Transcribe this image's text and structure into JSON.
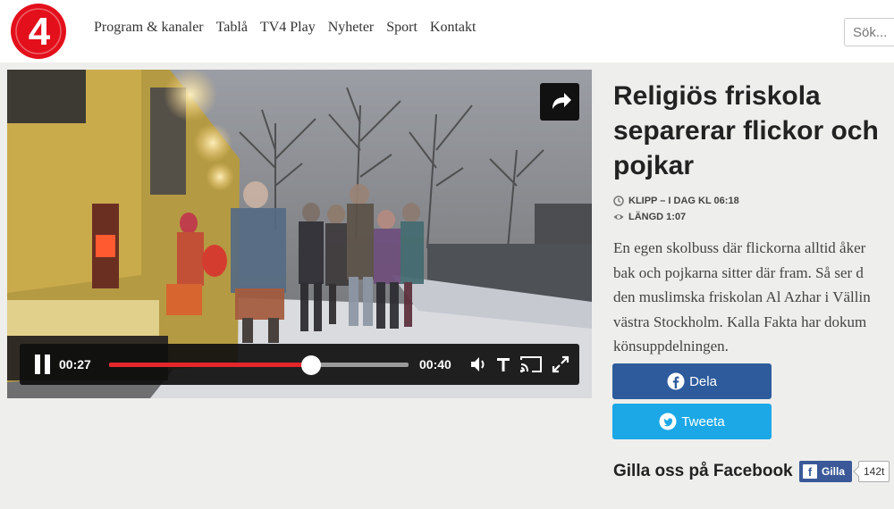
{
  "brand": {
    "logo_icon": "tv4-logo-icon",
    "logo_text": "4",
    "color": "#e3101b"
  },
  "nav": {
    "items": [
      {
        "label": "Program & kanaler"
      },
      {
        "label": "Tablå"
      },
      {
        "label": "TV4 Play"
      },
      {
        "label": "Nyheter"
      },
      {
        "label": "Sport"
      },
      {
        "label": "Kontakt"
      }
    ]
  },
  "search": {
    "placeholder": "Sök..."
  },
  "player": {
    "current_time": "00:27",
    "duration": "00:40",
    "progress_fraction": 0.675,
    "progress_color": "#e5262a",
    "icons": [
      "share-icon",
      "pause-icon",
      "volume-icon",
      "subtitles-icon",
      "cast-icon",
      "fullscreen-icon"
    ]
  },
  "article": {
    "title": "Religiös friskola separerar flickor och pojkar",
    "meta_clip": "KLIPP – I DAG KL 06:18",
    "meta_length": "LÄNGD 1:07",
    "lead_lines": [
      "En egen skolbuss där flickorna alltid åker",
      "bak och pojkarna sitter där fram. Så ser d",
      "den muslimska friskolan Al Azhar i Vällin",
      "västra Stockholm. Kalla Fakta har dokum",
      "könsuppdelningen."
    ]
  },
  "share": {
    "facebook_label": "Dela",
    "twitter_label": "Tweeta",
    "facebook_color": "#2d5b9c",
    "twitter_color": "#1ca8e6"
  },
  "facebook_widget": {
    "heading": "Gilla oss på Facebook",
    "like_label": "Gilla",
    "like_count": "142t"
  }
}
